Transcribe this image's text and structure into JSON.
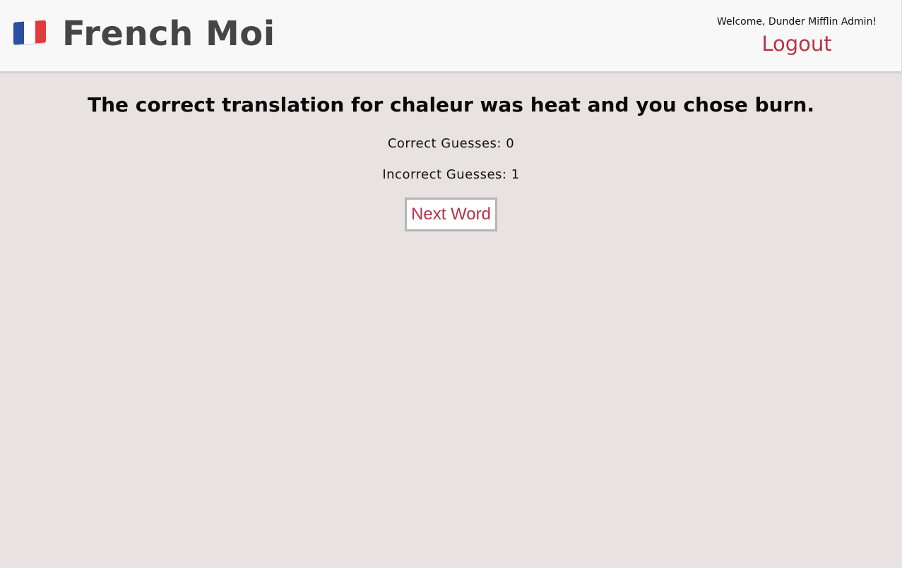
{
  "header": {
    "flag_icon": "france-flag-icon",
    "flag_colors": [
      "#2a4fa3",
      "#ffffff",
      "#e33b3b"
    ],
    "brand": "French Moi",
    "welcome": "Welcome, Dunder Mifflin Admin!",
    "logout_label": "Logout"
  },
  "main": {
    "feedback": "The correct translation for chaleur was heat and you chose burn.",
    "correct_guesses": "Correct Guesses: 0",
    "incorrect_guesses": "Incorrect Guesses: 1",
    "next_button_label": "Next Word"
  },
  "colors": {
    "accent": "#b8334a",
    "background": "#e8e2e2",
    "header_bg": "#f8f8f8"
  }
}
